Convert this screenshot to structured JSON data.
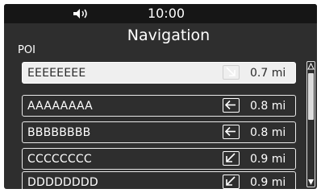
{
  "header": {
    "volume_icon": "speaker-volume-icon",
    "time": "10:00",
    "title": "Navigation"
  },
  "section_label": "POI",
  "poi_list": [
    {
      "name": "EEEEEEEE",
      "direction_icon": "arrow-down-right-icon",
      "distance": "0.7 mi",
      "selected": true
    },
    {
      "name": "AAAAAAAA",
      "direction_icon": "arrow-left-icon",
      "distance": "0.8 mi",
      "selected": false
    },
    {
      "name": "BBBBBBBB",
      "direction_icon": "arrow-left-icon",
      "distance": "0.8 mi",
      "selected": false
    },
    {
      "name": "CCCCCCCC",
      "direction_icon": "arrow-down-left-icon",
      "distance": "0.9 mi",
      "selected": false
    },
    {
      "name": "DDDDDDDD",
      "direction_icon": "arrow-down-left-icon",
      "distance": "0.9 mi",
      "selected": false
    }
  ],
  "colors": {
    "background": "#2e2e2e",
    "top_bar": "#161616",
    "text": "#ffffff",
    "selected_row_bg": "#efefef",
    "selected_row_text": "#2a2a2a"
  }
}
